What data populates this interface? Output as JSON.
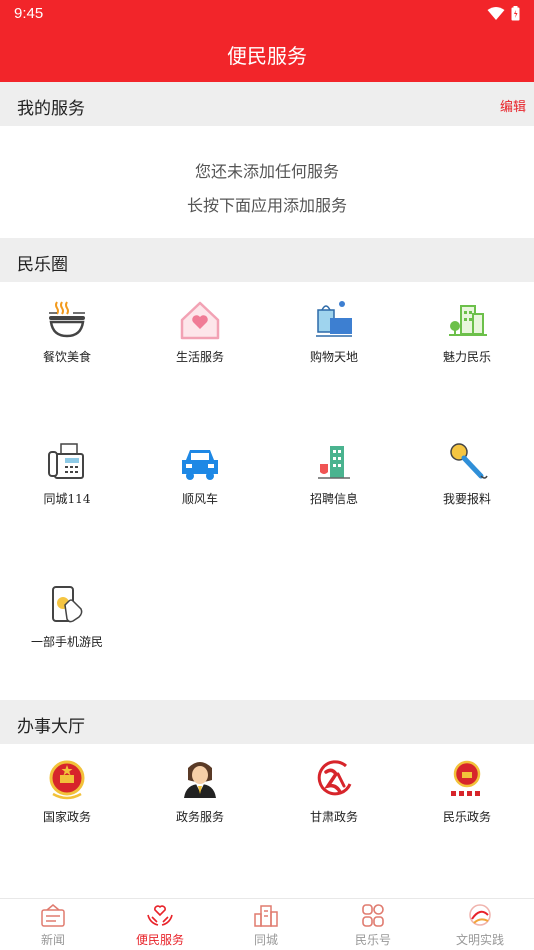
{
  "status_bar": {
    "time": "9:45"
  },
  "header": {
    "title": "便民服务"
  },
  "my_services": {
    "heading": "我的服务",
    "edit_label": "编辑",
    "empty_line1": "您还未添加任何服务",
    "empty_line2": "长按下面应用添加服务"
  },
  "minle_circle": {
    "heading": "民乐圈",
    "items": [
      {
        "label": "餐饮美食",
        "icon": "food-bowl-icon"
      },
      {
        "label": "生活服务",
        "icon": "house-heart-icon"
      },
      {
        "label": "购物天地",
        "icon": "shopping-bags-icon"
      },
      {
        "label": "魅力民乐",
        "icon": "city-buildings-icon"
      },
      {
        "label": "同城114",
        "icon": "fax-phone-icon"
      },
      {
        "label": "顺风车",
        "icon": "taxi-icon"
      },
      {
        "label": "招聘信息",
        "icon": "office-building-icon"
      },
      {
        "label": "我要报料",
        "icon": "microphone-icon"
      },
      {
        "label": "一部手机游民",
        "icon": "phone-touch-icon"
      }
    ]
  },
  "office_hall": {
    "heading": "办事大厅",
    "items": [
      {
        "label": "国家政务",
        "icon": "national-emblem-icon"
      },
      {
        "label": "政务服务",
        "icon": "service-agent-icon"
      },
      {
        "label": "甘肃政务",
        "icon": "gansu-logo-icon"
      },
      {
        "label": "民乐政务",
        "icon": "minle-emblem-icon"
      }
    ]
  },
  "bottom_nav": {
    "items": [
      {
        "label": "新闻",
        "active": false
      },
      {
        "label": "便民服务",
        "active": true
      },
      {
        "label": "同城",
        "active": false
      },
      {
        "label": "民乐号",
        "active": false
      },
      {
        "label": "文明实践",
        "active": false
      }
    ]
  },
  "colors": {
    "brand_red": "#f2252a",
    "section_bg": "#eeeeee",
    "active_tab": "#e8232a",
    "inactive_tab": "#999999"
  }
}
